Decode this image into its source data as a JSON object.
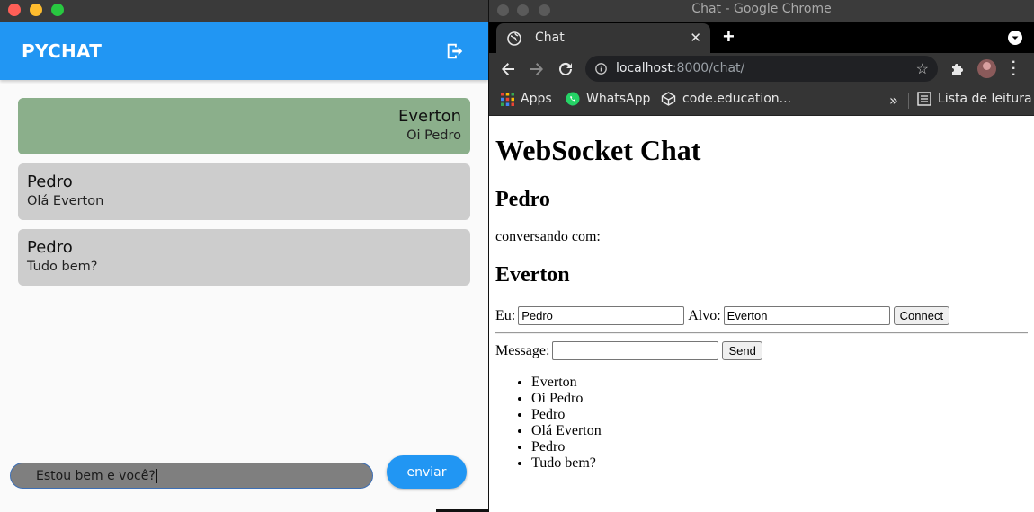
{
  "app": {
    "title": "PYCHAT",
    "messages": [
      {
        "author": "Everton",
        "text": "Oi Pedro",
        "mine": true
      },
      {
        "author": "Pedro",
        "text": "Olá Everton",
        "mine": false
      },
      {
        "author": "Pedro",
        "text": "Tudo bem?",
        "mine": false
      }
    ],
    "input_value": "Estou bem e você?",
    "send_label": "enviar",
    "colors": {
      "appbar": "#2196f3",
      "mine_bubble": "#8baf8b",
      "other_bubble": "#cdcdcd"
    }
  },
  "browser": {
    "window_title": "Chat - Google Chrome",
    "tab_label": "Chat",
    "url_host": "localhost",
    "url_rest": ":8000/chat/",
    "bookmarks": [
      "Apps",
      "WhatsApp",
      "code.education...",
      "Lista de leitura"
    ],
    "page": {
      "heading": "WebSocket Chat",
      "user": "Pedro",
      "conversing_label": "conversando com:",
      "target": "Everton",
      "me_label": "Eu:",
      "me_value": "Pedro",
      "target_label": "Alvo:",
      "target_value": "Everton",
      "connect_label": "Connect",
      "message_label": "Message:",
      "message_value": "",
      "send_label": "Send",
      "log": [
        "Everton",
        "Oi Pedro",
        "Pedro",
        "Olá Everton",
        "Pedro",
        "Tudo bem?"
      ]
    }
  }
}
